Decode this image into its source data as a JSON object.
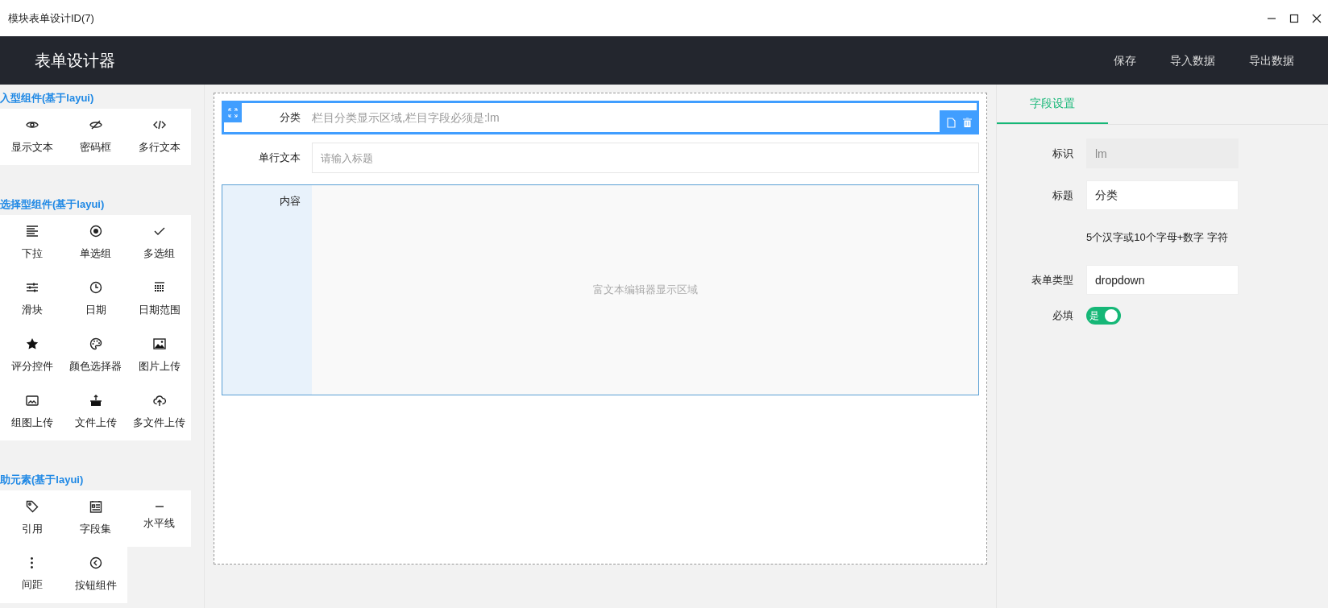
{
  "window": {
    "title": "模块表单设计ID(7)"
  },
  "header": {
    "title": "表单设计器",
    "actions": [
      "保存",
      "导入数据",
      "导出数据"
    ]
  },
  "palette": [
    {
      "heading": "入型组件(基于layui)",
      "items": [
        "显示文本",
        "密码框",
        "多行文本"
      ]
    },
    {
      "heading": "选择型组件(基于layui)",
      "items": [
        "下拉",
        "单选组",
        "多选组",
        "滑块",
        "日期",
        "日期范围",
        "评分控件",
        "颜色选择器",
        "图片上传",
        "组图上传",
        "文件上传",
        "多文件上传"
      ]
    },
    {
      "heading": "助元素(基于layui)",
      "items": [
        "引用",
        "字段集",
        "水平线",
        "间距",
        "按钮组件"
      ]
    }
  ],
  "canvas": {
    "fields": [
      {
        "kind": "text",
        "label": "分类",
        "placeholder": "栏目分类显示区域,栏目字段必须是:lm",
        "selected": true
      },
      {
        "kind": "text",
        "label": "单行文本",
        "placeholder": "请输入标题",
        "selected": false
      },
      {
        "kind": "richtext",
        "label": "内容",
        "placeholder": "富文本编辑器显示区域",
        "selected": false
      }
    ]
  },
  "settings": {
    "tabs": [
      {
        "label": "字段设置",
        "selected": true
      }
    ],
    "rows": [
      {
        "kind": "input",
        "label": "标识",
        "value": "lm",
        "disabled": true
      },
      {
        "kind": "input",
        "label": "标题",
        "value": "分类",
        "disabled": false
      },
      {
        "kind": "hint",
        "text": "5个汉字或10个字母+数字 字符"
      },
      {
        "kind": "input",
        "label": "表单类型",
        "value": "dropdown",
        "disabled": false
      },
      {
        "kind": "switch",
        "label": "必填",
        "text": "是",
        "on": true
      }
    ]
  }
}
